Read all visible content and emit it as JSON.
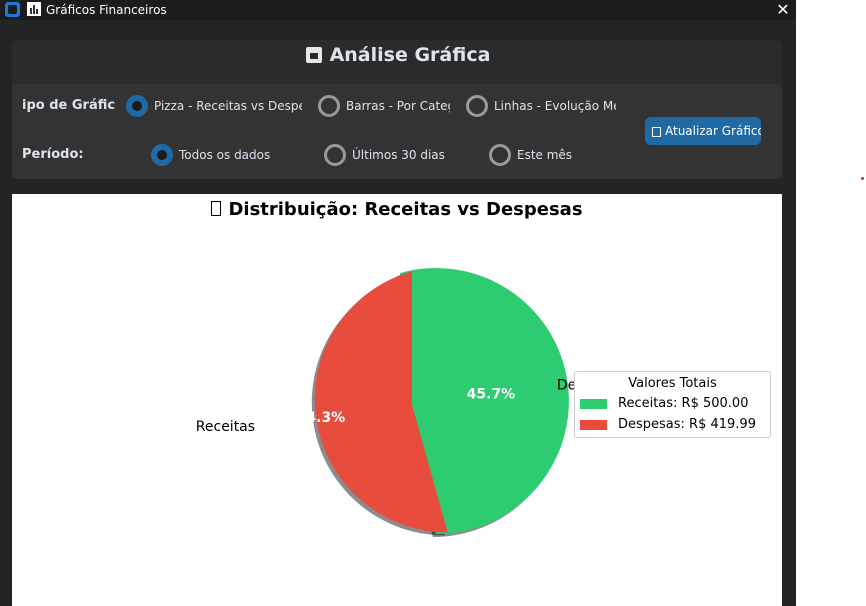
{
  "window": {
    "title": "Gráficos Financeiros",
    "close_glyph": "✕",
    "icons": [
      "app-icon",
      "bar-chart-icon"
    ]
  },
  "header": {
    "title": "Análise Gráfica",
    "title_icon": "box-icon"
  },
  "chart_type": {
    "label": "ipo de Gráfic",
    "options": [
      {
        "label": "Pizza - Receitas vs Despe",
        "selected": true
      },
      {
        "label": "Barras - Por Categ",
        "selected": false
      },
      {
        "label": "Linhas - Evolução Me",
        "selected": false
      }
    ]
  },
  "period": {
    "label": "Período:",
    "options": [
      {
        "label": "Todos os dados",
        "selected": true
      },
      {
        "label": "Últimos 30 dias",
        "selected": false
      },
      {
        "label": "Este mês",
        "selected": false
      }
    ]
  },
  "update_button": {
    "label": "Atualizar Gráfico",
    "icon": "refresh-icon"
  },
  "colors": {
    "receitas": "#2ecc71",
    "despesas": "#e74c3c",
    "accent": "#1f6aa5"
  },
  "chart_data": {
    "type": "pie",
    "title": "Distribuição: Receitas vs Despesas",
    "labels": [
      "Receitas",
      "Despesas"
    ],
    "values": [
      500.0,
      419.99
    ],
    "percent_labels": [
      "54.3%",
      "45.7%"
    ],
    "explode": [
      false,
      true
    ],
    "shadow": true,
    "start_angle_deg": 90,
    "legend": {
      "title": "Valores Totais",
      "placement": "right",
      "entries": [
        "Receitas: R$ 500.00",
        "Despesas: R$ 419.99"
      ]
    }
  }
}
